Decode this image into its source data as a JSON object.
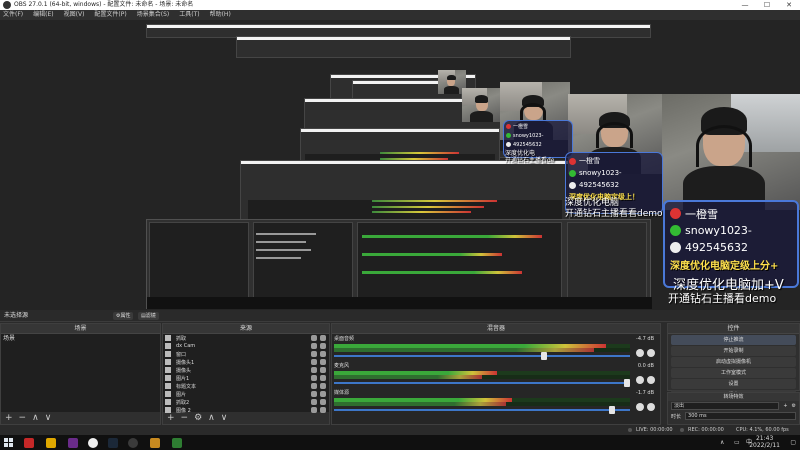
{
  "window": {
    "title": "OBS 27.0.1 (64-bit, windows) - 配置文件: 未命名 - 场景: 未命名",
    "controls": [
      "—",
      "☐",
      "✕"
    ]
  },
  "menu": [
    "文件(F)",
    "编辑(E)",
    "视图(V)",
    "配置文件(P)",
    "场景集合(S)",
    "工具(T)",
    "帮助(H)"
  ],
  "overlay": {
    "main": {
      "name": "一橙雪",
      "wechat": "snowy1023-",
      "qq": "492545632",
      "promo": "深度优化电脑定级上分+"
    },
    "mid": {
      "name": "一橙雪",
      "wechat": "snowy1023-",
      "qq": "492545632",
      "promo": "深度优化电脑定级上！"
    },
    "small": {
      "name": "一橙雪",
      "wechat": "snowy1023-",
      "qq": "492545632"
    }
  },
  "subtitles": {
    "large_line1": "深度优化电脑加+V",
    "large_line2": "开通钻石主播看demo",
    "mid_line1": "深度优化电脑",
    "mid_line2": "开通钻石主播看看demo",
    "small_line1": "深度优化电",
    "small_line2": "开通钻石主播看de"
  },
  "dock_header": {
    "scene_label": "未选择源",
    "properties_btn": "⚙属性",
    "filters_btn": "▤滤镜"
  },
  "scenes": {
    "title": "场景",
    "items": [
      "场景"
    ],
    "footer": [
      "+",
      "−",
      "∧",
      "∨"
    ]
  },
  "sources": {
    "title": "来源",
    "items": [
      "抓取",
      "dx Cam",
      "窗口",
      "摄像头1",
      "摄像头",
      "图片1",
      "标题文本",
      "图片",
      "抓取2",
      "图像 2"
    ],
    "footer": [
      "+",
      "−",
      "⚙",
      "∧",
      "∨"
    ]
  },
  "mixer": {
    "title": "混音器",
    "channels": [
      {
        "name": "桌面音频",
        "db": "-4.7 dB",
        "level": 0.92,
        "level2": 0.88,
        "fader": 0.72
      },
      {
        "name": "麦克风",
        "db": "0.0 dB",
        "level": 0.55,
        "level2": 0.5,
        "fader": 1.0
      },
      {
        "name": "媒体源",
        "db": "-1.7 dB",
        "level": 0.6,
        "level2": 0.58,
        "fader": 0.95
      }
    ]
  },
  "controls": {
    "title": "控件",
    "buttons": [
      "停止推流",
      "开始录制",
      "启动虚拟摄像机",
      "工作室模式",
      "设置",
      "退出"
    ]
  },
  "transitions": {
    "title": "转场特效",
    "selected": "淡出",
    "duration_label": "时长",
    "duration_value": "300 ms"
  },
  "status": {
    "live": "LIVE: 00:00:00",
    "rec": "REC: 00:00:00",
    "cpu": "CPU: 4.1%, 60.00 fps"
  },
  "taskbar": {
    "time": "21:43",
    "date": "2022/2/11",
    "ime": "中"
  },
  "colors": {
    "accent": "#3d76c8",
    "meter_green": "#3aa83a",
    "overlay_border": "#4a78d8",
    "promo_yellow": "#ffe14d"
  }
}
